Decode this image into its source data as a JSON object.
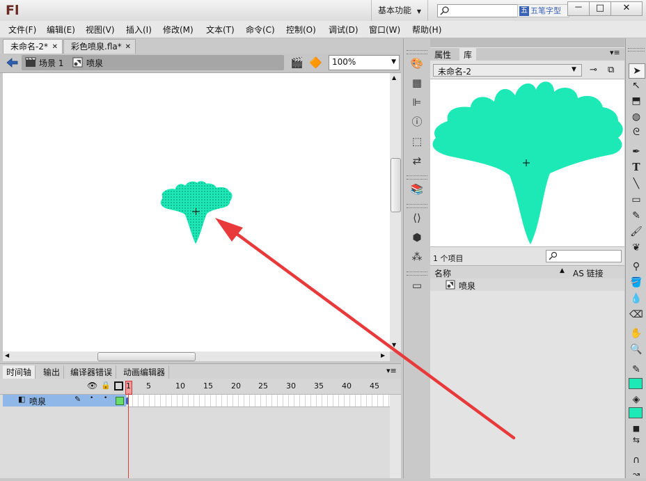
{
  "app": {
    "logo": "Fl",
    "workspace_label": "基本功能",
    "ime_label": "五笔字型"
  },
  "window_buttons": [
    "－",
    "□",
    "✕"
  ],
  "menu": [
    "文件(F)",
    "编辑(E)",
    "视图(V)",
    "插入(I)",
    "修改(M)",
    "文本(T)",
    "命令(C)",
    "控制(O)",
    "调试(D)",
    "窗口(W)",
    "帮助(H)"
  ],
  "doc_tabs": [
    {
      "label": "未命名-2*",
      "active": true
    },
    {
      "label": "彩色喷泉.fla*",
      "active": false
    }
  ],
  "edit_bar": {
    "scene_label": "场景 1",
    "symbol_label": "喷泉",
    "zoom": "100%"
  },
  "timeline": {
    "tabs": [
      "时间轴",
      "输出",
      "编译器错误",
      "动画编辑器"
    ],
    "frame_numbers": [
      "1",
      "5",
      "10",
      "15",
      "20",
      "25",
      "30",
      "35",
      "40",
      "45"
    ],
    "layers": [
      {
        "name": "喷泉"
      }
    ]
  },
  "library": {
    "tabs": [
      "属性",
      "库"
    ],
    "document": "未命名-2",
    "item_count": "1 个项目",
    "columns": [
      "名称",
      "AS 链接"
    ],
    "items": [
      {
        "name": "喷泉"
      }
    ]
  },
  "colors": {
    "shape_fill": "#1de9b6",
    "playhead": "#e23b3b",
    "arrow": "#e83a3a",
    "layer_selected": "#8fb8e8"
  },
  "icons": {
    "dock": [
      "color-icon",
      "swatches-icon",
      "align-icon",
      "info-icon",
      "transform-icon",
      "motion-presets-icon",
      "library-icon",
      "code-snippets-icon",
      "components-icon",
      "behaviors-icon",
      "screens-icon"
    ],
    "tools": [
      "selection-tool-icon",
      "subselection-tool-icon",
      "free-transform-tool-icon",
      "3d-rotation-tool-icon",
      "lasso-tool-icon",
      "pen-tool-icon",
      "text-tool-icon",
      "line-tool-icon",
      "rectangle-tool-icon",
      "pencil-tool-icon",
      "brush-tool-icon",
      "deco-tool-icon",
      "bone-tool-icon",
      "paint-bucket-tool-icon",
      "eyedropper-tool-icon",
      "eraser-tool-icon",
      "hand-tool-icon",
      "zoom-tool-icon",
      "stroke-color-icon",
      "fill-color-icon",
      "swap-colors-icon",
      "snap-magnet-icon"
    ]
  }
}
